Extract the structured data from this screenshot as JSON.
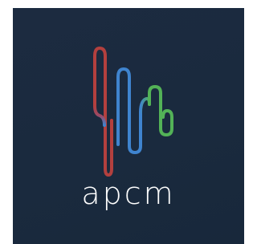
{
  "logo": {
    "wordmark": "apcm",
    "icon_name": "waveform-logo-icon",
    "colors": {
      "background": "#1b2a3e",
      "red": "#b3403e",
      "blue": "#3f84cf",
      "green": "#53b257",
      "text": "#ffffff"
    }
  }
}
